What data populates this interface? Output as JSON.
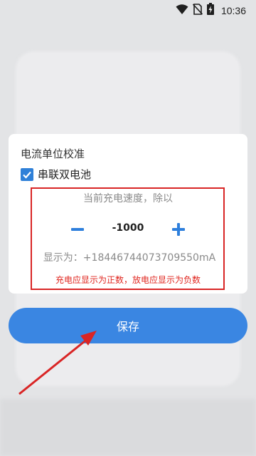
{
  "status_bar": {
    "time": "10:36",
    "icons": [
      "wifi-icon",
      "no-sim-icon",
      "battery-charging-icon"
    ]
  },
  "dialog": {
    "title": "电流单位校准",
    "checkbox": {
      "label": "串联双电池",
      "checked": true
    },
    "speed_label": "当前充电速度，除以",
    "stepper": {
      "value": "-1000",
      "minus_icon": "minus-icon",
      "plus_icon": "plus-icon"
    },
    "display_text": "显示为：+18446744073709550mA",
    "hint_text": "充电应显示为正数，放电应显示为负数"
  },
  "save_button": {
    "label": "保存"
  },
  "colors": {
    "accent": "#3a86e2",
    "warning": "#e0261f",
    "annotation": "#d92525"
  }
}
